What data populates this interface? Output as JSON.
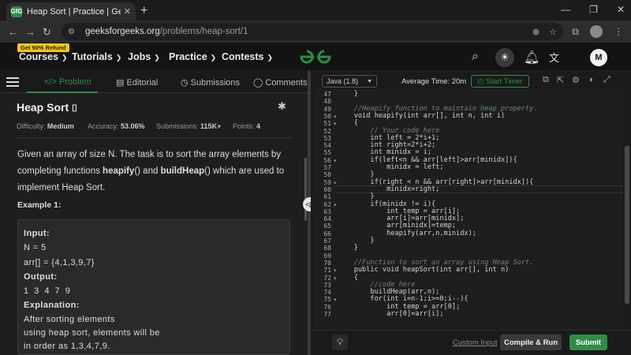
{
  "browser": {
    "tab_title": "Heap Sort | Practice | GeeksforG",
    "tab_favicon": "GfG",
    "url_host": "geeksforgeeks.org",
    "url_path": "/problems/heap-sort/1"
  },
  "header": {
    "refund_badge": "Get 90% Refund",
    "menu": [
      "Courses",
      "Tutorials",
      "Jobs",
      "Practice",
      "Contests"
    ],
    "logo": "GfG",
    "avatar_initial": "M"
  },
  "left_tabs": {
    "problem": "Problem",
    "editorial": "Editorial",
    "submissions": "Submissions",
    "comments": "Comments"
  },
  "problem": {
    "title": "Heap Sort",
    "difficulty_label": "Difficulty:",
    "difficulty": "Medium",
    "accuracy_label": "Accuracy:",
    "accuracy": "53.06%",
    "submissions_label": "Submissions:",
    "submissions": "115K+",
    "points_label": "Points:",
    "points": "4",
    "desc_line1": "Given an array of size N. The task is to sort the array elements by",
    "desc_line2_a": "completing functions ",
    "desc_line2_b": "heapify",
    "desc_line2_c": "() and ",
    "desc_line2_d": "buildHeap",
    "desc_line2_e": "() which are used to",
    "desc_line3": "implement Heap Sort.",
    "example_title": "Example 1:",
    "example": {
      "input_label": "Input:",
      "n_line": "N = 5",
      "arr_line": "arr[] = {4,1,3,9,7}",
      "output_label": "Output:",
      "output_value": "1 3 4 7 9",
      "explanation_label": "Explanation:",
      "exp1": "After sorting elements",
      "exp2": "using heap sort, elements will be",
      "exp3": "in order as 1,3,4,7,9."
    }
  },
  "editor_toolbar": {
    "language": "Java (1.8)",
    "avg_time": "Average Time: 20m",
    "timer": "Start Timer"
  },
  "code_lines": [
    {
      "n": "47",
      "t": "    }",
      "k": ""
    },
    {
      "n": "48",
      "t": "",
      "k": ""
    },
    {
      "n": "49",
      "t": "    //Heapify function to maintain heap property.",
      "k": "c"
    },
    {
      "n": "50",
      "t": "    void heapify(int arr[], int n, int i)",
      "k": ""
    },
    {
      "n": "51",
      "t": "    {",
      "k": ""
    },
    {
      "n": "52",
      "t": "        // Your code here",
      "k": "c"
    },
    {
      "n": "53",
      "t": "        int left = 2*i+1;",
      "k": ""
    },
    {
      "n": "54",
      "t": "        int right=2*i+2;",
      "k": ""
    },
    {
      "n": "55",
      "t": "        int minidx = i;",
      "k": ""
    },
    {
      "n": "56",
      "t": "        if(left<n && arr[left]>arr[minidx]){",
      "k": ""
    },
    {
      "n": "57",
      "t": "            minidx = left;",
      "k": ""
    },
    {
      "n": "58",
      "t": "        }",
      "k": ""
    },
    {
      "n": "59",
      "t": "        if(right < n && arr[right]>arr[minidx]){",
      "k": ""
    },
    {
      "n": "60",
      "t": "            minidx=right;",
      "k": ""
    },
    {
      "n": "61",
      "t": "        }",
      "k": ""
    },
    {
      "n": "62",
      "t": "        if(minidx != i){",
      "k": ""
    },
    {
      "n": "63",
      "t": "            int temp = arr[i];",
      "k": ""
    },
    {
      "n": "64",
      "t": "            arr[i]=arr[minidx];",
      "k": ""
    },
    {
      "n": "65",
      "t": "            arr[minidx]=temp;",
      "k": ""
    },
    {
      "n": "66",
      "t": "            heapify(arr,n,minidx);",
      "k": ""
    },
    {
      "n": "67",
      "t": "        }",
      "k": ""
    },
    {
      "n": "68",
      "t": "    }",
      "k": ""
    },
    {
      "n": "69",
      "t": "",
      "k": ""
    },
    {
      "n": "70",
      "t": "    //Function to sort an array using Heap Sort.",
      "k": "c"
    },
    {
      "n": "71",
      "t": "    public void heapSort(int arr[], int n)",
      "k": ""
    },
    {
      "n": "72",
      "t": "    {",
      "k": ""
    },
    {
      "n": "73",
      "t": "        //code here",
      "k": "c"
    },
    {
      "n": "74",
      "t": "        buildHeap(arr,n);",
      "k": ""
    },
    {
      "n": "75",
      "t": "        for(int i=n-1;i>=0;i--){",
      "k": ""
    },
    {
      "n": "76",
      "t": "            int temp = arr[0];",
      "k": ""
    },
    {
      "n": "77",
      "t": "            arr[0]=arr[i];",
      "k": ""
    }
  ],
  "bottom": {
    "custom_input": "Custom Input",
    "compile_run": "Compile & Run",
    "submit": "Submit"
  },
  "colors": {
    "accent_green": "#2f8d46",
    "refund_yellow": "#f5c518"
  }
}
